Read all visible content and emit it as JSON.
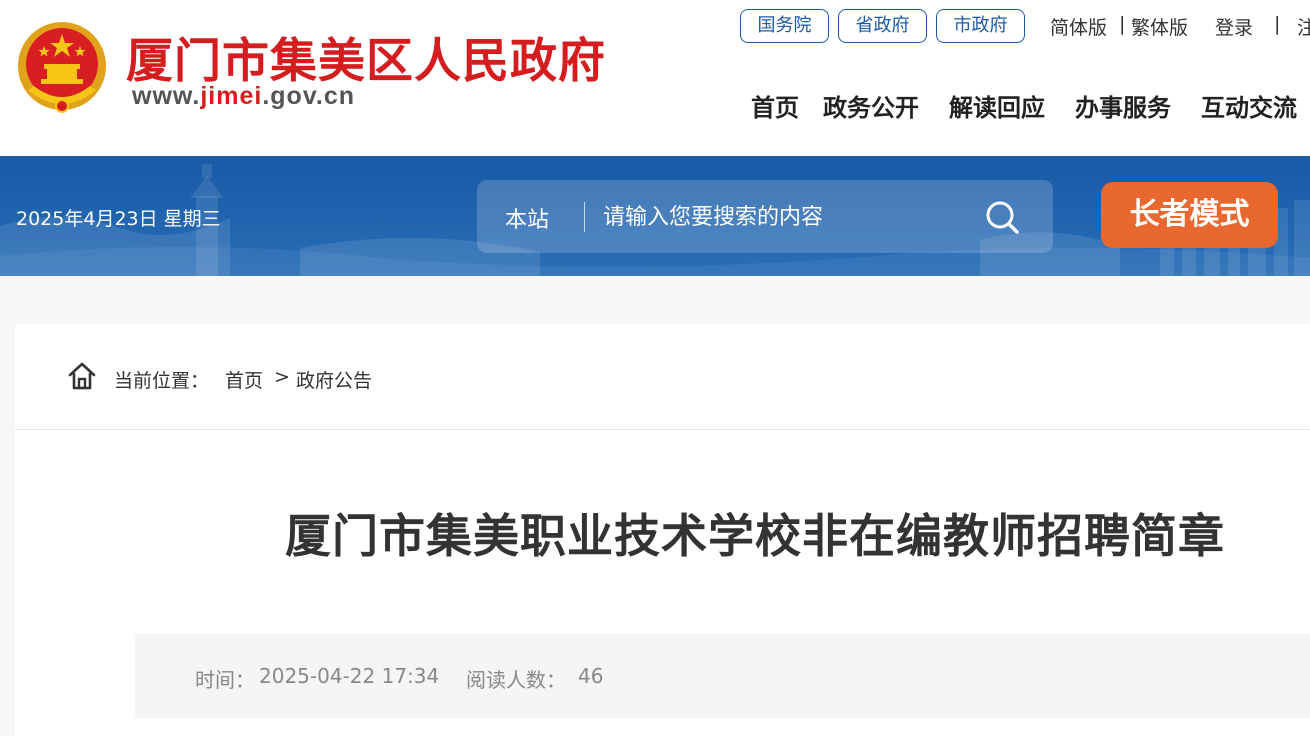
{
  "header": {
    "site_title": "厦门市集美区人民政府",
    "url_prefix": "www.",
    "url_highlight": "jimei",
    "url_suffix": ".gov.cn",
    "gov_links": [
      "国务院",
      "省政府",
      "市政府"
    ],
    "simplified_label": "简体版",
    "divider": "|",
    "traditional_label": "繁体版",
    "login_label": "登录",
    "register_partial": "注",
    "nav": [
      "首页",
      "政务公开",
      "解读回应",
      "办事服务",
      "互动交流"
    ]
  },
  "banner": {
    "date_text": "2025年4月23日 星期三",
    "search_scope": "本站",
    "search_placeholder": "请输入您要搜索的内容",
    "elder_mode_label": "长者模式"
  },
  "breadcrumb": {
    "label": "当前位置：",
    "items": [
      "首页",
      "政府公告"
    ],
    "separator": ">"
  },
  "article": {
    "title": "厦门市集美职业技术学校非在编教师招聘简章",
    "time_label": "时间：",
    "time_value": "2025-04-22 17:34",
    "readers_label": "阅读人数：",
    "readers_value": "46"
  },
  "colors": {
    "brand_red": "#d51d1f",
    "link_blue": "#1d5aa8",
    "banner_blue": "#1f62ad",
    "elder_orange": "#e8682f"
  },
  "icons": {
    "emblem": "national-emblem-icon",
    "search": "search-icon",
    "home": "home-icon"
  }
}
